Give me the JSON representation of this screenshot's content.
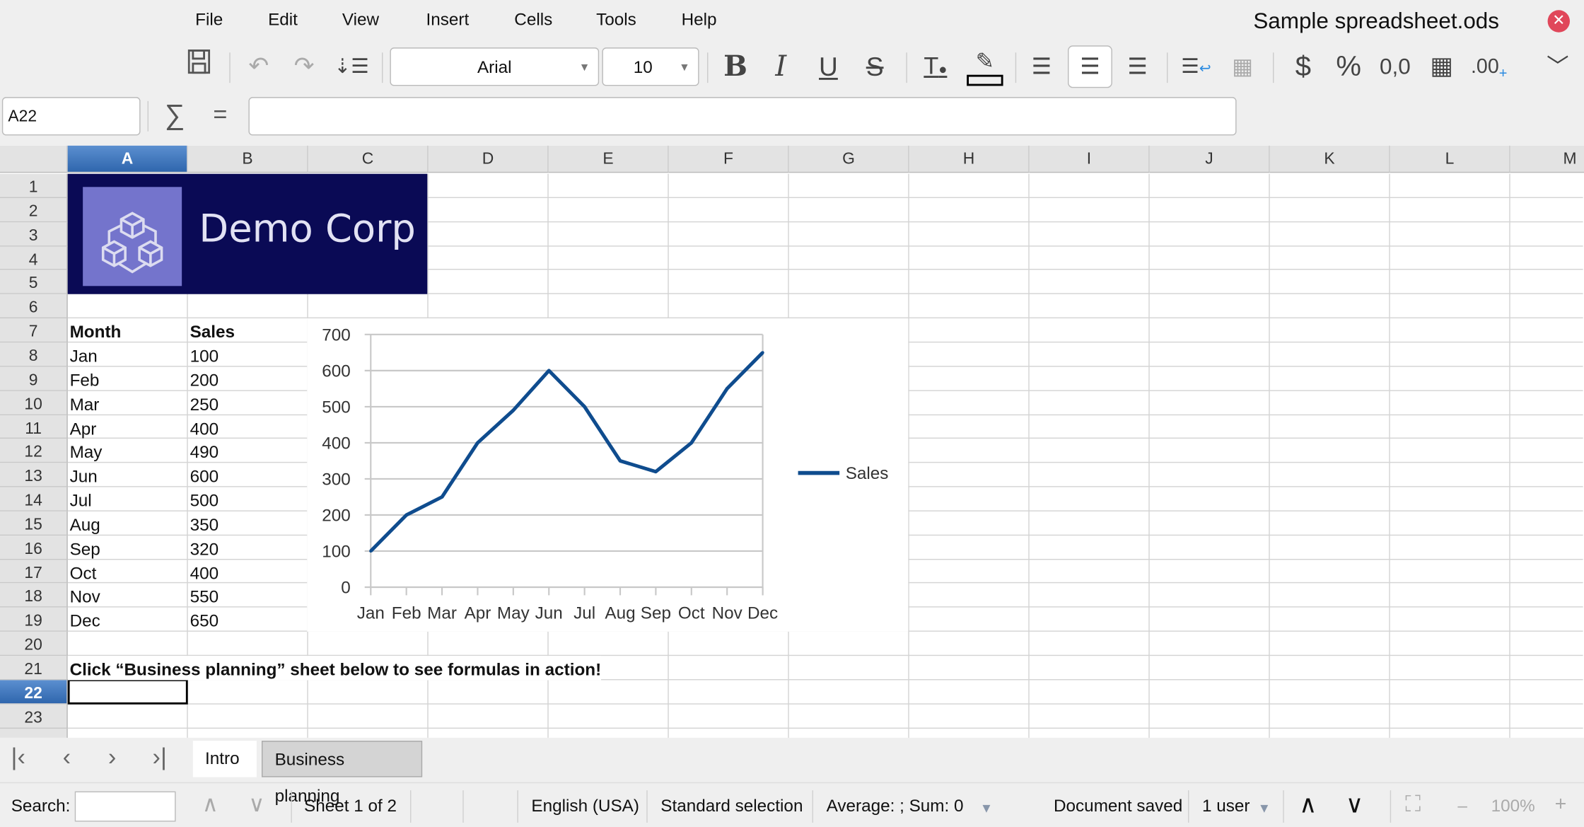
{
  "window": {
    "title": "Sample spreadsheet.ods",
    "close_icon": "close-icon"
  },
  "menu": [
    "File",
    "Edit",
    "View",
    "Insert",
    "Cells",
    "Tools",
    "Help"
  ],
  "toolbar": {
    "font_name": "Arial",
    "font_size": "10"
  },
  "formula_bar": {
    "cell_ref": "A22",
    "sum_symbol": "∑",
    "equals_symbol": "=",
    "value": ""
  },
  "columns": [
    "A",
    "B",
    "C",
    "D",
    "E",
    "F",
    "G",
    "H",
    "I",
    "J",
    "K",
    "L",
    "M"
  ],
  "rows": [
    "1",
    "2",
    "3",
    "4",
    "5",
    "6",
    "7",
    "8",
    "9",
    "10",
    "11",
    "12",
    "13",
    "14",
    "15",
    "16",
    "17",
    "18",
    "19",
    "20",
    "21",
    "22",
    "23"
  ],
  "selected": {
    "column": "A",
    "row": "22"
  },
  "logo": {
    "text": "Demo Corp",
    "bg": "#0a0a55",
    "icon_bg": "#7474cc"
  },
  "table": {
    "headers": [
      "Month",
      "Sales"
    ],
    "rows": [
      [
        "Jan",
        "100"
      ],
      [
        "Feb",
        "200"
      ],
      [
        "Mar",
        "250"
      ],
      [
        "Apr",
        "400"
      ],
      [
        "May",
        "490"
      ],
      [
        "Jun",
        "600"
      ],
      [
        "Jul",
        "500"
      ],
      [
        "Aug",
        "350"
      ],
      [
        "Sep",
        "320"
      ],
      [
        "Oct",
        "400"
      ],
      [
        "Nov",
        "550"
      ],
      [
        "Dec",
        "650"
      ]
    ]
  },
  "note": "Click “Business planning” sheet below to see formulas in action!",
  "chart_data": {
    "type": "line",
    "categories": [
      "Jan",
      "Feb",
      "Mar",
      "Apr",
      "May",
      "Jun",
      "Jul",
      "Aug",
      "Sep",
      "Oct",
      "Nov",
      "Dec"
    ],
    "series": [
      {
        "name": "Sales",
        "values": [
          100,
          200,
          250,
          400,
          490,
          600,
          500,
          350,
          320,
          400,
          550,
          650
        ],
        "color": "#0f4c8e"
      }
    ],
    "ylim": [
      0,
      700
    ],
    "yticks": [
      "0",
      "100",
      "200",
      "300",
      "400",
      "500",
      "600",
      "700"
    ],
    "grid": true,
    "legend": "right"
  },
  "sheet_tabs": [
    {
      "label": "Intro",
      "active": true
    },
    {
      "label": "Business planning",
      "active": false
    }
  ],
  "status": {
    "search_label": "Search:",
    "sheet": "Sheet 1 of 2",
    "language": "English (USA)",
    "selection_mode": "Standard selection",
    "summary": "Average: ; Sum: 0",
    "doc_state": "Document saved",
    "users": "1 user",
    "zoom": "100%"
  }
}
